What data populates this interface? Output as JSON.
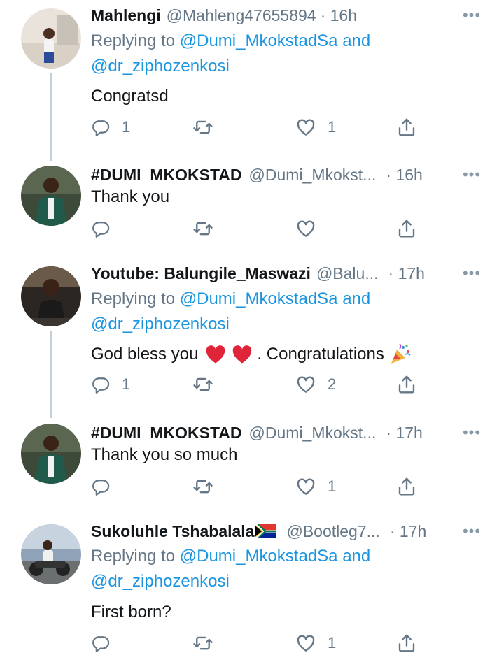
{
  "replying_to_label": "Replying to",
  "replying_and": "and",
  "more_label": "•••",
  "tweets": [
    {
      "name": "Mahlengi",
      "handle": "@Mahleng47655894",
      "time": "· 16h",
      "mentions": [
        "@Dumi_MkokstadSa",
        "@dr_ziphozenkosi"
      ],
      "text": "Congratsd",
      "counts": {
        "reply": "1",
        "retweet": "",
        "like": "1"
      }
    },
    {
      "name": "#DUMI_MKOKSTAD",
      "handle": "@Dumi_Mkokst...",
      "time": "· 16h",
      "text": "Thank you",
      "counts": {
        "reply": "",
        "retweet": "",
        "like": ""
      }
    },
    {
      "name": "Youtube: Balungile_Maswazi",
      "handle": "@Balu...",
      "time": "· 17h",
      "mentions": [
        "@Dumi_MkokstadSa",
        "@dr_ziphozenkosi"
      ],
      "text_before": "God bless you",
      "text_after": ". Congratulations",
      "counts": {
        "reply": "1",
        "retweet": "",
        "like": "2"
      }
    },
    {
      "name": "#DUMI_MKOKSTAD",
      "handle": "@Dumi_Mkokst...",
      "time": "· 17h",
      "text": "Thank you so much",
      "counts": {
        "reply": "",
        "retweet": "",
        "like": "1"
      }
    },
    {
      "name": "Sukoluhle Tshabalala",
      "handle": "@Bootleg7...",
      "time": "· 17h",
      "mentions": [
        "@Dumi_MkokstadSa",
        "@dr_ziphozenkosi"
      ],
      "text": "First born?",
      "counts": {
        "reply": "",
        "retweet": "",
        "like": "1"
      }
    }
  ],
  "colors": {
    "link": "#1b95e0",
    "muted": "#657786",
    "thread_line": "#c4cfd6",
    "divider": "#e1e8ed"
  }
}
